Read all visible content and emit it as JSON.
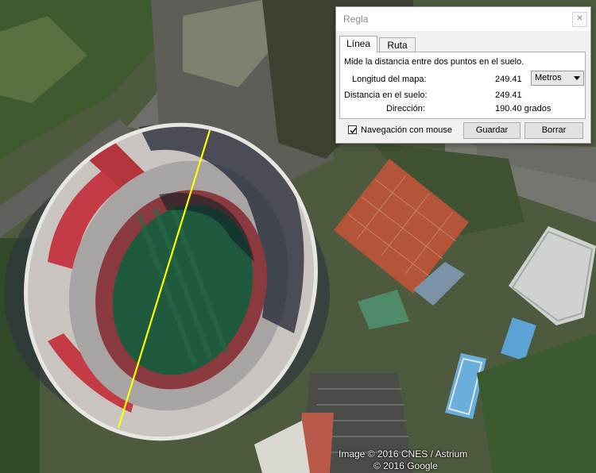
{
  "map": {
    "attribution_line1": "Image © 2016 CNES / Astrium",
    "attribution_line2": "© 2016 Google",
    "measure_line_color": "#ffff00"
  },
  "dialog": {
    "title": "Regla",
    "close_icon": "close-icon",
    "tabs": [
      {
        "label": "Línea",
        "active": true
      },
      {
        "label": "Ruta",
        "active": false
      }
    ],
    "description": "Mide la distancia entre dos puntos en el suelo.",
    "map_length_label": "Longitud del mapa:",
    "map_length_value": "249.41",
    "unit_selected": "Metros",
    "ground_distance_label": "Distancia en el suelo:",
    "ground_distance_value": "249.41",
    "direction_label": "Dirección:",
    "direction_value": "190.40 grados",
    "mouse_nav_label": "Navegación con mouse",
    "mouse_nav_checked": true,
    "save_label": "Guardar",
    "clear_label": "Borrar"
  }
}
